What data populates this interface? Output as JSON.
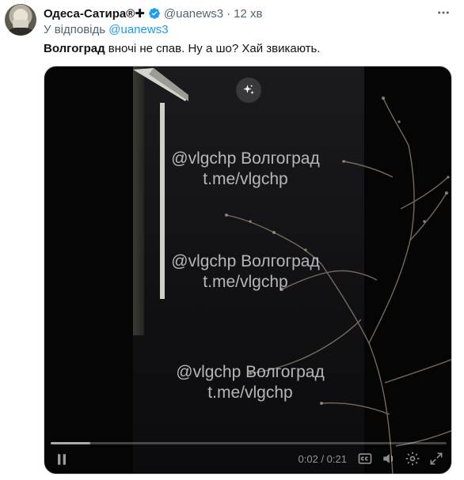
{
  "tweet": {
    "author_name": "Одеса-Сатира®✚",
    "handle": "@uanews3",
    "separator": "·",
    "time": "12 хв",
    "reply_prefix": "У відповідь",
    "reply_mention": "@uanews3",
    "text_bold": "Волгоград",
    "text_rest": " вночі не спав. Ну а шо? Хай звикають."
  },
  "media": {
    "watermarks": [
      {
        "line1": "@vlgchp Волгоград",
        "line2": "t.me/vlgchp"
      },
      {
        "line1": "@vlgchp Волгоград",
        "line2": "t.me/vlgchp"
      },
      {
        "line1": "@vlgchp Волгоград",
        "line2": "t.me/vlgchp"
      }
    ],
    "player": {
      "time_readout": "0:02 / 0:21",
      "progress_fraction": 0.1
    }
  },
  "colors": {
    "link": "#1d9bf0",
    "verified_badge": "#1d9bf0",
    "secondary_text": "#536471"
  },
  "icons": {
    "more": "more-dots-icon",
    "verified": "verified-badge-icon",
    "magic": "sparkle-icon",
    "play": "pause-icon",
    "captions": "captions-icon",
    "volume": "volume-icon",
    "settings": "gear-icon",
    "fullscreen": "fullscreen-icon"
  }
}
